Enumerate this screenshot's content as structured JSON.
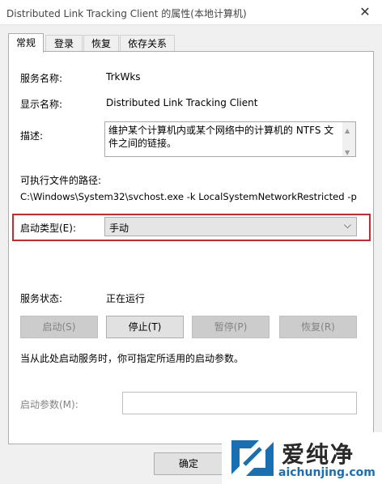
{
  "window": {
    "title": "Distributed Link Tracking Client 的属性(本地计算机)",
    "close_glyph": "✕"
  },
  "tabs": [
    {
      "label": "常规"
    },
    {
      "label": "登录"
    },
    {
      "label": "恢复"
    },
    {
      "label": "依存关系"
    }
  ],
  "general": {
    "service_name_label": "服务名称:",
    "service_name_value": "TrkWks",
    "display_name_label": "显示名称:",
    "display_name_value": "Distributed Link Tracking Client",
    "description_label": "描述:",
    "description_value": "维护某个计算机内或某个网络中的计算机的 NTFS 文件之间的链接。",
    "exe_path_label": "可执行文件的路径:",
    "exe_path_value": "C:\\Windows\\System32\\svchost.exe -k LocalSystemNetworkRestricted -p",
    "startup_type_label": "启动类型(E):",
    "startup_type_value": "手动",
    "service_status_label": "服务状态:",
    "service_status_value": "正在运行",
    "start_button": "启动(S)",
    "stop_button": "停止(T)",
    "pause_button": "暂停(P)",
    "resume_button": "恢复(R)",
    "hint_text": "当从此处启动服务时，你可指定所适用的启动参数。",
    "start_params_label": "启动参数(M):",
    "start_params_value": ""
  },
  "footer": {
    "ok_button": "确定"
  },
  "watermark": {
    "text_cn": "爱纯净",
    "text_en": "aichunjing.com"
  },
  "colors": {
    "highlight": "#d9232a",
    "accent": "#1a6fb0"
  }
}
